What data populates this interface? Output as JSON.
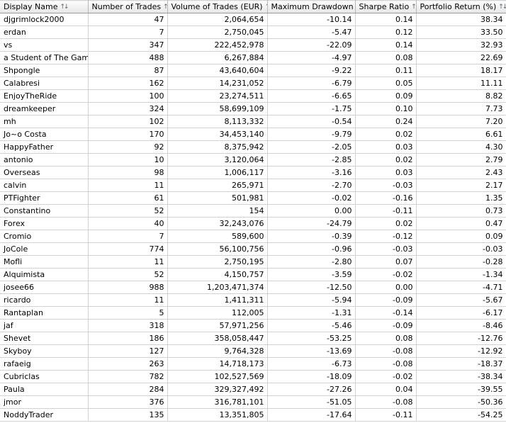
{
  "columns": [
    {
      "key": "name",
      "label": "Display Name",
      "icon": "sort-arrows-icon"
    },
    {
      "key": "trades",
      "label": "Number of Trades",
      "icon": "sort-arrows-icon"
    },
    {
      "key": "volume",
      "label": "Volume of Trades (EUR)",
      "icon": "sort-arrows-icon"
    },
    {
      "key": "drawdown",
      "label": "Maximum Drawdown",
      "icon": "sort-arrows-icon"
    },
    {
      "key": "sharpe",
      "label": "Sharpe Ratio",
      "icon": "sort-arrows-icon"
    },
    {
      "key": "return",
      "label": "Portfolio Return (%)",
      "icon": "sort-arrows-icon"
    }
  ],
  "rows": [
    [
      "djgrimlock2000",
      "47",
      "2,064,654",
      "-10.14",
      "0.14",
      "38.34"
    ],
    [
      "erdan",
      "7",
      "2,750,045",
      "-5.47",
      "0.12",
      "33.50"
    ],
    [
      "vs",
      "347",
      "222,452,978",
      "-22.09",
      "0.14",
      "32.93"
    ],
    [
      "a Student of The Game",
      "488",
      "6,267,884",
      "-4.97",
      "0.08",
      "22.69"
    ],
    [
      "Shpongle",
      "87",
      "43,640,604",
      "-9.22",
      "0.11",
      "18.17"
    ],
    [
      "Calabresi",
      "162",
      "14,231,052",
      "-6.79",
      "0.05",
      "11.11"
    ],
    [
      "EnjoyTheRide",
      "100",
      "23,274,511",
      "-6.65",
      "0.09",
      "8.82"
    ],
    [
      "dreamkeeper",
      "324",
      "58,699,109",
      "-1.75",
      "0.10",
      "7.73"
    ],
    [
      "mh",
      "102",
      "8,113,332",
      "-0.54",
      "0.24",
      "7.20"
    ],
    [
      "Jo~o Costa",
      "170",
      "34,453,140",
      "-9.79",
      "0.02",
      "6.61"
    ],
    [
      "HappyFather",
      "92",
      "8,375,942",
      "-2.05",
      "0.03",
      "4.30"
    ],
    [
      "antonio",
      "10",
      "3,120,064",
      "-2.85",
      "0.02",
      "2.79"
    ],
    [
      "Overseas",
      "98",
      "1,006,117",
      "-3.16",
      "0.03",
      "2.43"
    ],
    [
      "calvin",
      "11",
      "265,971",
      "-2.70",
      "-0.03",
      "2.17"
    ],
    [
      "PTFighter",
      "61",
      "501,981",
      "-0.02",
      "-0.16",
      "1.35"
    ],
    [
      "Constantino",
      "52",
      "154",
      "0.00",
      "-0.11",
      "0.73"
    ],
    [
      "Forex",
      "40",
      "32,243,076",
      "-24.79",
      "0.02",
      "0.47"
    ],
    [
      "Cromio",
      "7",
      "589,600",
      "-0.39",
      "-0.12",
      "0.09"
    ],
    [
      "JoCole",
      "774",
      "56,100,756",
      "-0.96",
      "-0.03",
      "-0.03"
    ],
    [
      "Mofli",
      "11",
      "2,750,195",
      "-2.80",
      "0.07",
      "-0.28"
    ],
    [
      "Alquimista",
      "52",
      "4,150,757",
      "-3.59",
      "-0.02",
      "-1.34"
    ],
    [
      "josee66",
      "988",
      "1,203,471,374",
      "-12.50",
      "0.00",
      "-4.71"
    ],
    [
      "ricardo",
      "11",
      "1,411,311",
      "-5.94",
      "-0.09",
      "-5.67"
    ],
    [
      "Rantaplan",
      "5",
      "112,005",
      "-1.31",
      "-0.14",
      "-6.17"
    ],
    [
      "jaf",
      "318",
      "57,971,256",
      "-5.46",
      "-0.09",
      "-8.46"
    ],
    [
      "Shevet",
      "186",
      "358,058,447",
      "-53.25",
      "0.08",
      "-12.76"
    ],
    [
      "Skyboy",
      "127",
      "9,764,328",
      "-13.69",
      "-0.08",
      "-12.92"
    ],
    [
      "rafaeig",
      "263",
      "14,718,173",
      "-6.73",
      "-0.08",
      "-18.37"
    ],
    [
      "Cubriclas",
      "782",
      "102,527,569",
      "-18.09",
      "-0.02",
      "-38.34"
    ],
    [
      "Paula",
      "284",
      "329,327,492",
      "-27.26",
      "0.04",
      "-39.55"
    ],
    [
      "jmor",
      "376",
      "316,781,101",
      "-51.05",
      "-0.08",
      "-50.36"
    ],
    [
      "NoddyTrader",
      "135",
      "13,351,805",
      "-17.64",
      "-0.11",
      "-54.25"
    ]
  ]
}
